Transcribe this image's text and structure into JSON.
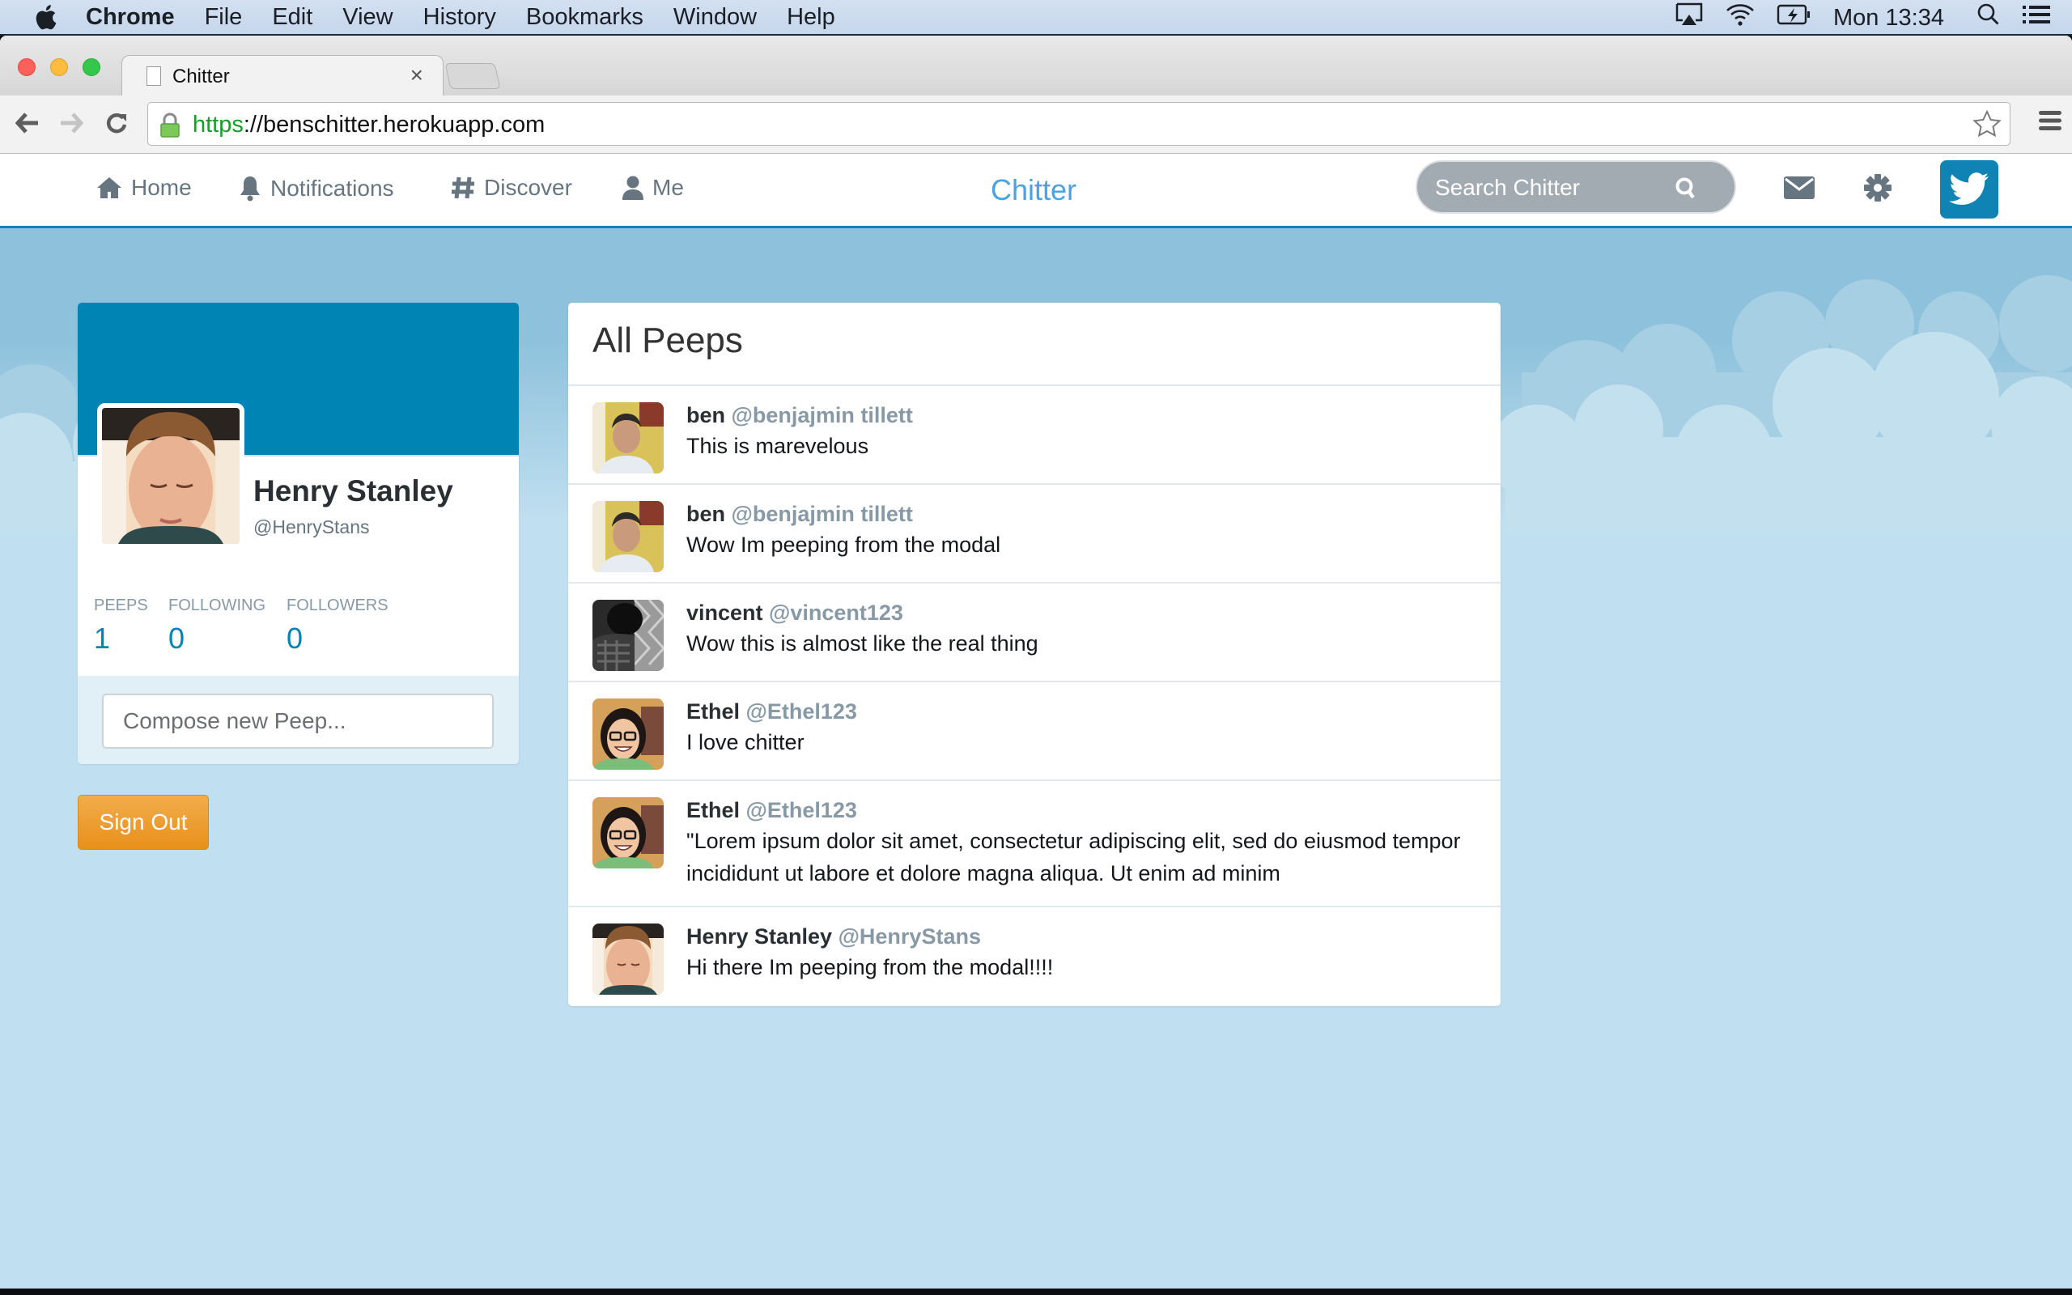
{
  "menubar": {
    "app_name": "Chrome",
    "items": [
      "File",
      "Edit",
      "View",
      "History",
      "Bookmarks",
      "Window",
      "Help"
    ],
    "clock": "Mon 13:34"
  },
  "browser": {
    "tab_title": "Chitter",
    "url_scheme": "https",
    "url_rest": "://benschitter.herokuapp.com"
  },
  "nav": {
    "items": [
      {
        "label": "Home",
        "icon": "home-icon"
      },
      {
        "label": "Notifications",
        "icon": "bell-icon"
      },
      {
        "label": "Discover",
        "icon": "hashtag-icon"
      },
      {
        "label": "Me",
        "icon": "user-icon"
      }
    ],
    "brand": "Chitter",
    "search_placeholder": "Search Chitter",
    "accent_color": "#0084b4"
  },
  "profile": {
    "name": "Henry Stanley",
    "handle": "@HenryStans",
    "stats": [
      {
        "label": "PEEPS",
        "value": "1"
      },
      {
        "label": "FOLLOWING",
        "value": "0"
      },
      {
        "label": "FOLLOWERS",
        "value": "0"
      }
    ],
    "compose_placeholder": "Compose new Peep...",
    "sign_out_label": "Sign Out"
  },
  "feed": {
    "title": "All Peeps",
    "peeps": [
      {
        "name": "ben",
        "handle": "@benjajmin tillett",
        "text": "This is marevelous",
        "avatar": "ben"
      },
      {
        "name": "ben",
        "handle": "@benjajmin tillett",
        "text": "Wow Im peeping from the modal",
        "avatar": "ben"
      },
      {
        "name": "vincent",
        "handle": "@vincent123",
        "text": "Wow this is almost like the real thing",
        "avatar": "vincent"
      },
      {
        "name": "Ethel",
        "handle": "@Ethel123",
        "text": "I love chitter",
        "avatar": "ethel"
      },
      {
        "name": "Ethel",
        "handle": "@Ethel123",
        "text": "\"Lorem ipsum dolor sit amet, consectetur adipiscing elit, sed do eiusmod tempor incididunt ut labore et dolore magna aliqua. Ut enim ad minim",
        "avatar": "ethel"
      },
      {
        "name": "Henry Stanley",
        "handle": "@HenryStans",
        "text": "Hi there Im peeping from the modal!!!!",
        "avatar": "henry"
      }
    ]
  }
}
